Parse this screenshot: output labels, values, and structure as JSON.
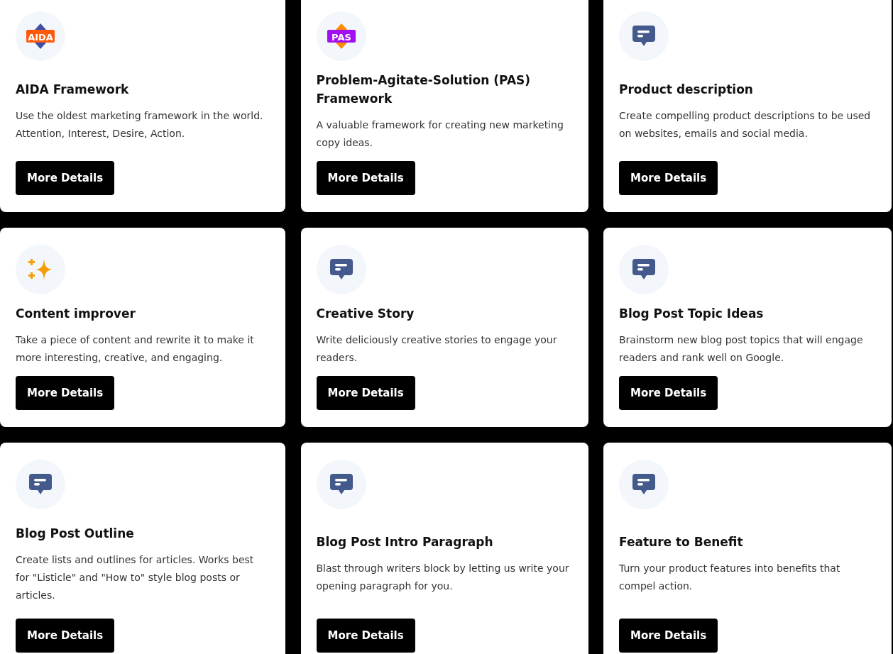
{
  "cards": [
    {
      "icon": {
        "kind": "orange-badge",
        "badge": "AIDA"
      },
      "title": "AIDA Framework",
      "description": "Use the oldest marketing framework in the world. Attention, Interest, Desire, Action.",
      "button": "More Details"
    },
    {
      "icon": {
        "kind": "purple-badge",
        "badge": "PAS"
      },
      "title": "Problem-Agitate-Solution (PAS) Framework",
      "description": "A valuable framework for creating new marketing copy ideas.",
      "button": "More Details"
    },
    {
      "icon": {
        "kind": "chat"
      },
      "title": "Product description",
      "description": "Create compelling product descriptions to be used on websites, emails and social media.",
      "button": "More Details"
    },
    {
      "icon": {
        "kind": "sparkle"
      },
      "title": "Content improver",
      "description": "Take a piece of content and rewrite it to make it more interesting, creative, and engaging.",
      "button": "More Details"
    },
    {
      "icon": {
        "kind": "chat"
      },
      "title": "Creative Story",
      "description": "Write deliciously creative stories to engage your readers.",
      "button": "More Details"
    },
    {
      "icon": {
        "kind": "chat"
      },
      "title": "Blog Post Topic Ideas",
      "description": "Brainstorm new blog post topics that will engage readers and rank well on Google.",
      "button": "More Details"
    },
    {
      "icon": {
        "kind": "chat"
      },
      "title": "Blog Post Outline",
      "description": "Create lists and outlines for articles. Works best for \"Listicle\" and \"How to\" style blog posts or articles.",
      "button": "More Details"
    },
    {
      "icon": {
        "kind": "chat"
      },
      "title": "Blog Post Intro Paragraph",
      "description": "Blast through writers block by letting us write your opening paragraph for you.",
      "button": "More Details"
    },
    {
      "icon": {
        "kind": "chat"
      },
      "title": "Feature to Benefit",
      "description": "Turn your product features into benefits that compel action.",
      "button": "More Details"
    }
  ]
}
